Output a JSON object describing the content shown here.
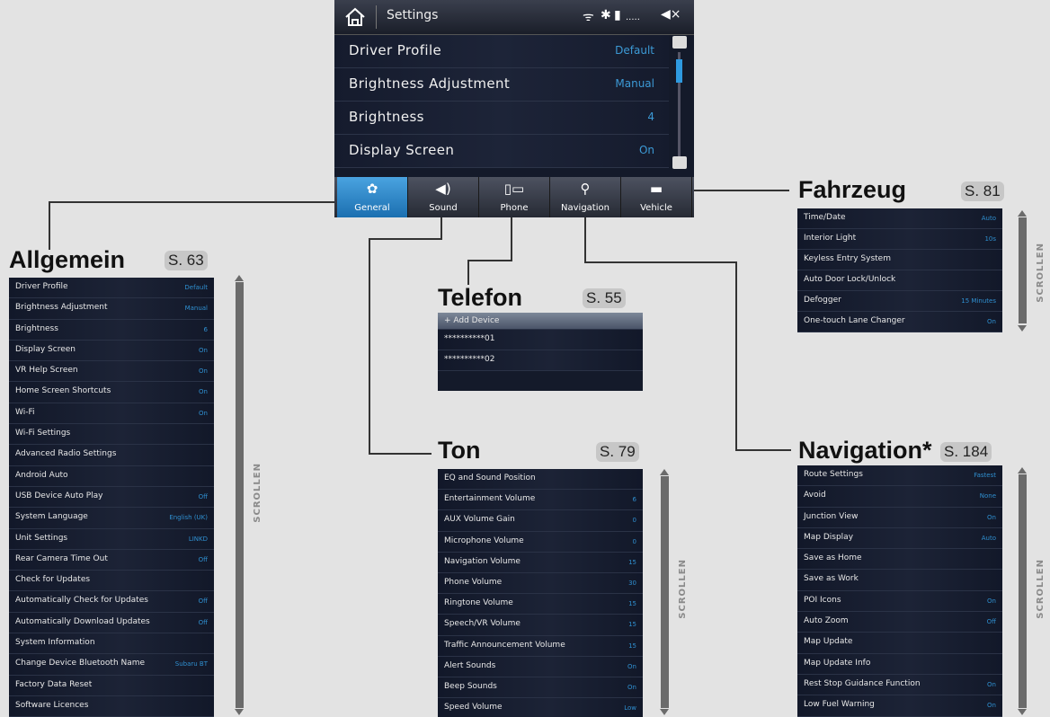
{
  "main": {
    "title": "Settings",
    "rows": [
      {
        "label": "Driver Profile",
        "value": "Default"
      },
      {
        "label": "Brightness Adjustment",
        "value": "Manual"
      },
      {
        "label": "Brightness",
        "value": "4"
      },
      {
        "label": "Display Screen",
        "value": "On"
      }
    ],
    "tabs": [
      {
        "label": "General",
        "icon": "gear-icon",
        "glyph": "✿"
      },
      {
        "label": "Sound",
        "icon": "speaker-icon",
        "glyph": "◀)"
      },
      {
        "label": "Phone",
        "icon": "phone-icon",
        "glyph": "▯▭"
      },
      {
        "label": "Navigation",
        "icon": "map-pin-icon",
        "glyph": "⚲"
      },
      {
        "label": "Vehicle",
        "icon": "car-icon",
        "glyph": "▬"
      }
    ]
  },
  "panels": {
    "allgemein": {
      "title": "Allgemein",
      "page": "S. 63",
      "scroll": "SCROLLEN",
      "rows": [
        {
          "label": "Driver Profile",
          "value": "Default"
        },
        {
          "label": "Brightness Adjustment",
          "value": "Manual"
        },
        {
          "label": "Brightness",
          "value": "6"
        },
        {
          "label": "Display Screen",
          "value": "On"
        },
        {
          "label": "VR Help Screen",
          "value": "On"
        },
        {
          "label": "Home Screen Shortcuts",
          "value": "On"
        },
        {
          "label": "Wi-Fi",
          "value": "On"
        },
        {
          "label": "Wi-Fi Settings",
          "value": ""
        },
        {
          "label": "Advanced Radio Settings",
          "value": ""
        },
        {
          "label": "Android Auto",
          "value": ""
        },
        {
          "label": "USB Device Auto Play",
          "value": "Off"
        },
        {
          "label": "System Language",
          "value": "English (UK)"
        },
        {
          "label": "Unit Settings",
          "value": "LINKD"
        },
        {
          "label": "Rear Camera Time Out",
          "value": "Off"
        },
        {
          "label": "Check for Updates",
          "value": ""
        },
        {
          "label": "Automatically Check for Updates",
          "value": "Off"
        },
        {
          "label": "Automatically Download Updates",
          "value": "Off"
        },
        {
          "label": "System Information",
          "value": ""
        },
        {
          "label": "Change Device Bluetooth Name",
          "value": "Subaru BT"
        },
        {
          "label": "Factory Data Reset",
          "value": ""
        },
        {
          "label": "Software Licences",
          "value": ""
        }
      ]
    },
    "telefon": {
      "title": "Telefon",
      "page": "S. 55",
      "add": "+ Add Device",
      "rows": [
        {
          "label": "**********01",
          "value": ""
        },
        {
          "label": "**********02",
          "value": ""
        }
      ]
    },
    "ton": {
      "title": "Ton",
      "page": "S. 79",
      "scroll": "SCROLLEN",
      "rows": [
        {
          "label": "EQ and Sound Position",
          "value": ""
        },
        {
          "label": "Entertainment Volume",
          "value": "6"
        },
        {
          "label": "AUX Volume Gain",
          "value": "0"
        },
        {
          "label": "Microphone Volume",
          "value": "0"
        },
        {
          "label": "Navigation Volume",
          "value": "15"
        },
        {
          "label": "Phone Volume",
          "value": "30"
        },
        {
          "label": "Ringtone Volume",
          "value": "15"
        },
        {
          "label": "Speech/VR Volume",
          "value": "15"
        },
        {
          "label": "Traffic Announcement Volume",
          "value": "15"
        },
        {
          "label": "Alert Sounds",
          "value": "On"
        },
        {
          "label": "Beep Sounds",
          "value": "On"
        },
        {
          "label": "Speed Volume",
          "value": "Low"
        }
      ]
    },
    "fahrzeug": {
      "title": "Fahrzeug",
      "page": "S. 81",
      "scroll": "SCROLLEN",
      "rows": [
        {
          "label": "Time/Date",
          "value": "Auto"
        },
        {
          "label": "Interior Light",
          "value": "10s"
        },
        {
          "label": "Keyless Entry System",
          "value": ""
        },
        {
          "label": "Auto Door Lock/Unlock",
          "value": ""
        },
        {
          "label": "Defogger",
          "value": "15 Minutes"
        },
        {
          "label": "One-touch Lane Changer",
          "value": "On"
        }
      ]
    },
    "navigation": {
      "title": "Navigation*",
      "page": "S. 184",
      "scroll": "SCROLLEN",
      "rows": [
        {
          "label": "Route Settings",
          "value": "Fastest"
        },
        {
          "label": "Avoid",
          "value": "None"
        },
        {
          "label": "Junction View",
          "value": "On"
        },
        {
          "label": "Map Display",
          "value": "Auto"
        },
        {
          "label": "Save as Home",
          "value": ""
        },
        {
          "label": "Save as Work",
          "value": ""
        },
        {
          "label": "POI Icons",
          "value": "On"
        },
        {
          "label": "Auto Zoom",
          "value": "Off"
        },
        {
          "label": "Map Update",
          "value": ""
        },
        {
          "label": "Map Update Info",
          "value": ""
        },
        {
          "label": "Rest Stop Guidance Function",
          "value": "On"
        },
        {
          "label": "Low Fuel Warning",
          "value": "On"
        }
      ]
    }
  }
}
